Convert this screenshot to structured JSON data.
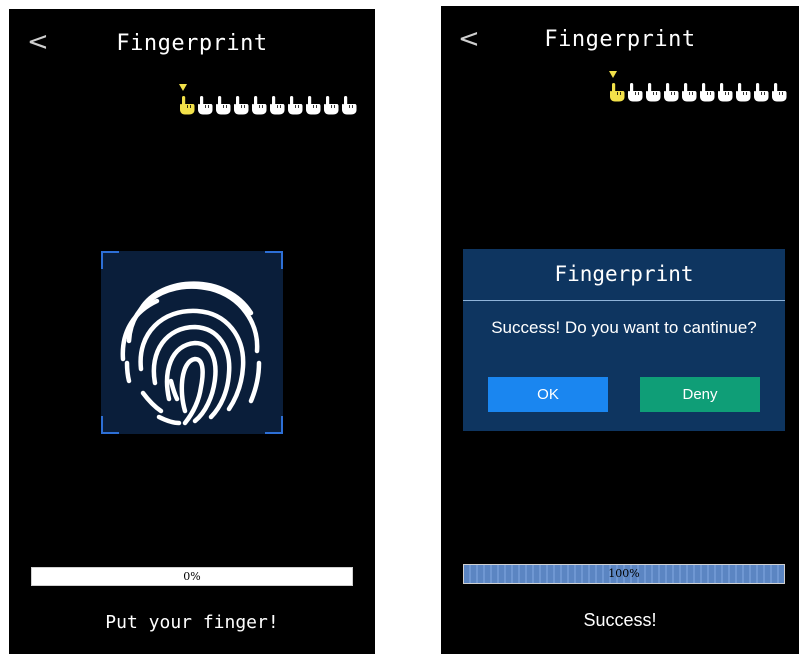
{
  "left_screen": {
    "title": "Fingerprint",
    "back_glyph": "<",
    "steps_total": 10,
    "current_step": 1,
    "progress_percent": 0,
    "progress_text": "0%",
    "status_text": "Put your finger!"
  },
  "right_screen": {
    "title": "Fingerprint",
    "back_glyph": "<",
    "steps_total": 10,
    "current_step": 1,
    "progress_percent": 100,
    "progress_text": "100%",
    "status_text": "Success!",
    "dialog": {
      "title": "Fingerprint",
      "message": "Success! Do you want to cantinue?",
      "ok_label": "OK",
      "deny_label": "Deny"
    }
  },
  "colors": {
    "background": "#000000",
    "active_step": "#f2e14a",
    "inactive_step": "#ffffff",
    "frame_corner": "#2d6fd6",
    "fingerprint_panel": "#0a1e3a",
    "dialog_bg": "#0e3560",
    "ok_button": "#1a86f0",
    "deny_button": "#0f9e77",
    "progress_fill": "#5b85c2"
  },
  "icons": {
    "back": "chevron-left-icon",
    "step": "pointing-hand-icon",
    "fingerprint": "fingerprint-icon"
  }
}
